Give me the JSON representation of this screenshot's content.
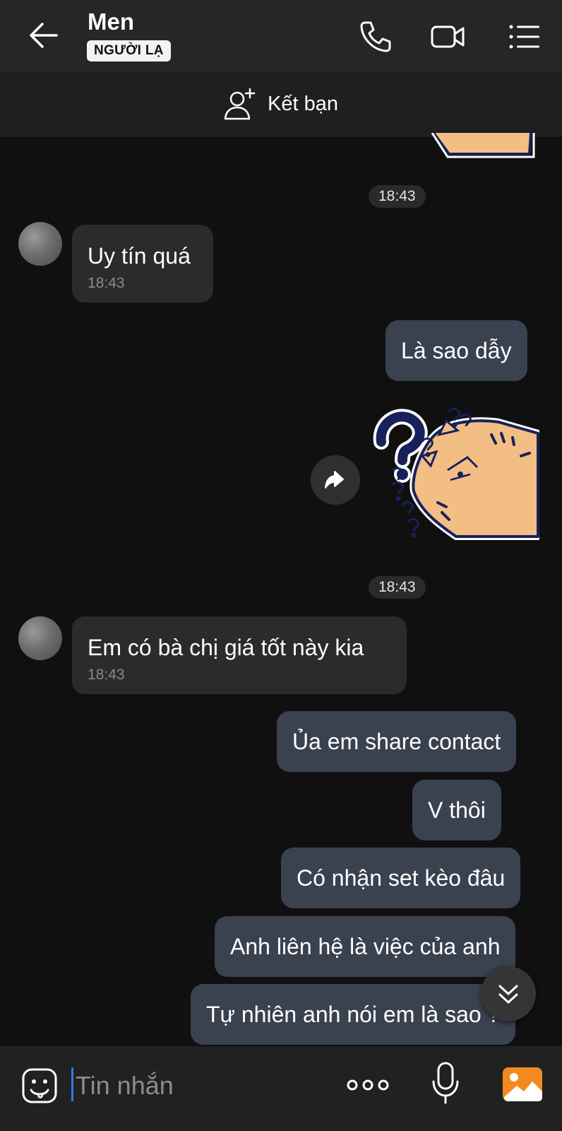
{
  "header": {
    "contact_name": "Men",
    "badge": "NGƯỜI LẠ",
    "icons": [
      "back-arrow-icon",
      "phone-icon",
      "video-call-icon",
      "menu-list-icon"
    ]
  },
  "friend_bar": {
    "label": "Kết bạn",
    "icon": "add-friend-icon"
  },
  "messages": [
    {
      "type": "timestamp",
      "text": "18:43"
    },
    {
      "type": "incoming",
      "text": "Uy tín quá",
      "time": "18:43"
    },
    {
      "type": "outgoing",
      "text": "Là sao dẫy"
    },
    {
      "type": "sticker",
      "from": "me",
      "icon": "question-cat-sticker"
    },
    {
      "type": "timestamp",
      "text": "18:43"
    },
    {
      "type": "incoming",
      "text": "Em có bà chị giá tốt này kia",
      "time": "18:43"
    },
    {
      "type": "outgoing",
      "text": "Ủa em share contact"
    },
    {
      "type": "outgoing",
      "text": "V thôi"
    },
    {
      "type": "outgoing",
      "text": "Có nhận set kèo đâu"
    },
    {
      "type": "outgoing",
      "text": "Anh liên hệ là việc của anh"
    },
    {
      "type": "outgoing",
      "text": "Tự nhiên anh nói em là sao ?"
    }
  ],
  "input_bar": {
    "placeholder": "Tin nhắn",
    "icons": [
      "emoji-icon",
      "more-dots-icon",
      "microphone-icon",
      "gallery-icon"
    ]
  },
  "colors": {
    "background": "#101010",
    "header": "#262626",
    "incoming_bubble": "#2b2b2b",
    "outgoing_bubble": "#3a4250",
    "cursor": "#2b7de9",
    "gallery_orange": "#f28a1f",
    "sticker_navy": "#17215a",
    "sticker_cat": "#f3be84"
  }
}
